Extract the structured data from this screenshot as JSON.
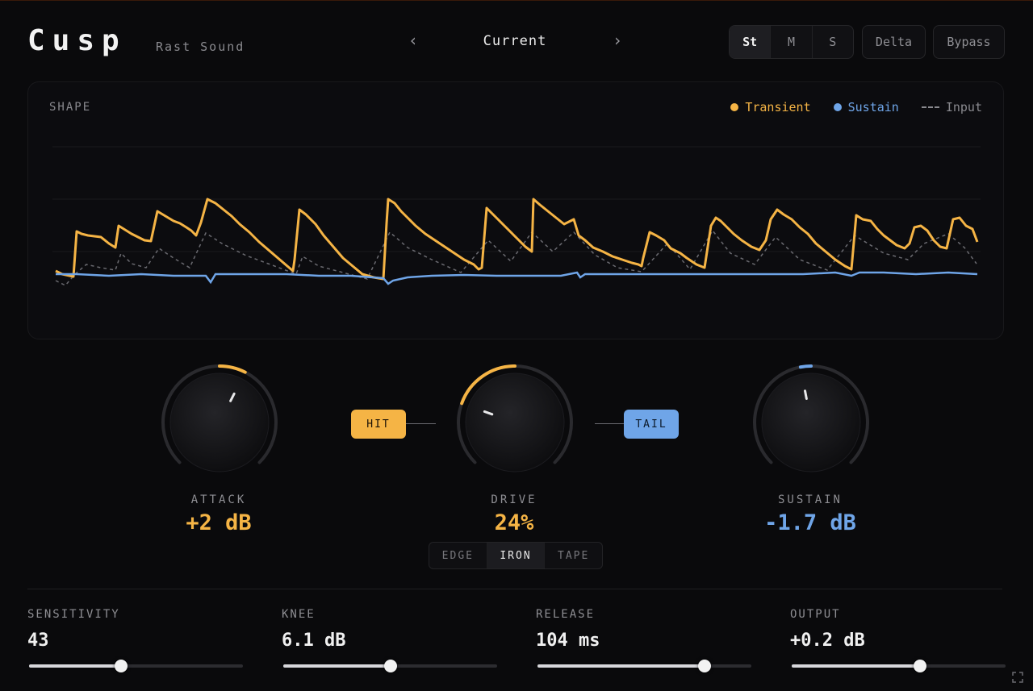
{
  "app": {
    "name": "Cusp",
    "vendor": "Rast Sound"
  },
  "preset": {
    "name": "Current",
    "prev_icon": "chevron-left-icon",
    "next_icon": "chevron-right-icon"
  },
  "channel_modes": [
    {
      "label": "St",
      "active": true
    },
    {
      "label": "M",
      "active": false
    },
    {
      "label": "S",
      "active": false
    }
  ],
  "toggles": {
    "delta": "Delta",
    "bypass": "Bypass"
  },
  "shape": {
    "title": "SHAPE",
    "legend": [
      {
        "label": "Transient",
        "color": "#f5b445",
        "style": "dot"
      },
      {
        "label": "Sustain",
        "color": "#6fa5e8",
        "style": "dot"
      },
      {
        "label": "Input",
        "color": "#8a8a8f",
        "style": "dashed"
      }
    ]
  },
  "knobs": {
    "attack": {
      "label": "ATTACK",
      "value": "+2 dB",
      "color": "#f5b445",
      "position": 0.6
    },
    "drive": {
      "label": "DRIVE",
      "value": "24%",
      "color": "#f5b445",
      "position": 0.24
    },
    "sustain": {
      "label": "SUSTAIN",
      "value": "-1.7 dB",
      "color": "#6fa5e8",
      "position": 0.46
    }
  },
  "tags": {
    "hit": "HIT",
    "tail": "TAIL"
  },
  "drive_modes": [
    {
      "label": "EDGE",
      "active": false
    },
    {
      "label": "IRON",
      "active": true
    },
    {
      "label": "TAPE",
      "active": false
    }
  ],
  "params": [
    {
      "label": "SENSITIVITY",
      "value": "43",
      "level": 0.43
    },
    {
      "label": "KNEE",
      "value": "6.1 dB",
      "level": 0.5
    },
    {
      "label": "RELEASE",
      "value": "104 ms",
      "level": 0.78
    },
    {
      "label": "OUTPUT",
      "value": "+0.2 dB",
      "level": 0.6
    }
  ],
  "colors": {
    "transient": "#f5b445",
    "sustain": "#6fa5e8",
    "input": "#8a8a8f",
    "background": "#0a0a0c"
  }
}
